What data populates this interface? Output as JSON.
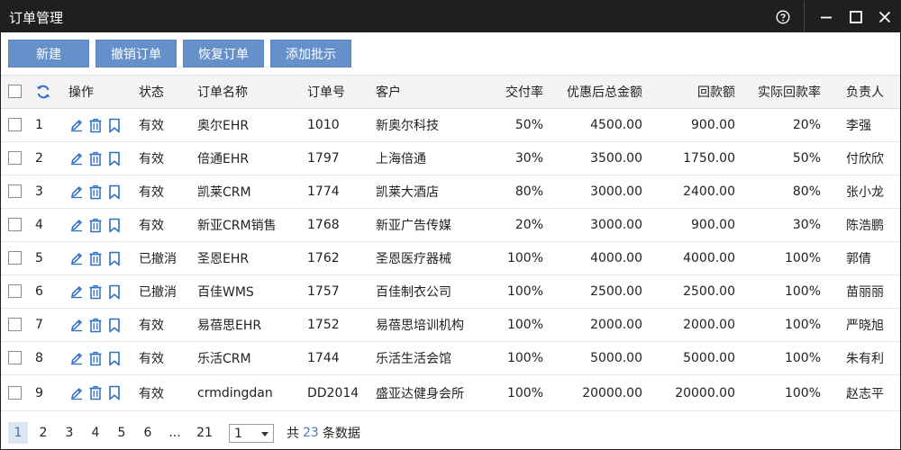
{
  "window": {
    "title": "订单管理",
    "icons": [
      "help-icon",
      "minimize-icon",
      "maximize-icon",
      "close-icon"
    ]
  },
  "toolbar": {
    "buttons": [
      "新建",
      "撤销订单",
      "恢复订单",
      "添加批示"
    ]
  },
  "columns": {
    "action": "操作",
    "status": "状态",
    "name": "订单名称",
    "order_no": "订单号",
    "customer": "客户",
    "delivery_rate": "交付率",
    "total": "优惠后总金额",
    "paid": "回款额",
    "paid_rate": "实际回款率",
    "owner": "负责人"
  },
  "rows": [
    {
      "idx": "1",
      "status": "有效",
      "name": "奥尔EHR",
      "order_no": "1010",
      "customer": "新奥尔科技",
      "delivery_rate": "50%",
      "total": "4500.00",
      "paid": "900.00",
      "paid_rate": "20%",
      "owner": "李强"
    },
    {
      "idx": "2",
      "status": "有效",
      "name": "倍通EHR",
      "order_no": "1797",
      "customer": "上海倍通",
      "delivery_rate": "30%",
      "total": "3500.00",
      "paid": "1750.00",
      "paid_rate": "50%",
      "owner": "付欣欣"
    },
    {
      "idx": "3",
      "status": "有效",
      "name": "凯莱CRM",
      "order_no": "1774",
      "customer": "凯莱大酒店",
      "delivery_rate": "80%",
      "total": "3000.00",
      "paid": "2400.00",
      "paid_rate": "80%",
      "owner": "张小龙"
    },
    {
      "idx": "4",
      "status": "有效",
      "name": "新亚CRM销售",
      "order_no": "1768",
      "customer": "新亚广告传媒",
      "delivery_rate": "20%",
      "total": "3000.00",
      "paid": "900.00",
      "paid_rate": "30%",
      "owner": "陈浩鹏"
    },
    {
      "idx": "5",
      "status": "已撤消",
      "name": "圣恩EHR",
      "order_no": "1762",
      "customer": "圣恩医疗器械",
      "delivery_rate": "100%",
      "total": "4000.00",
      "paid": "4000.00",
      "paid_rate": "100%",
      "owner": "郭倩"
    },
    {
      "idx": "6",
      "status": "已撤消",
      "name": "百佳WMS",
      "order_no": "1757",
      "customer": "百佳制衣公司",
      "delivery_rate": "100%",
      "total": "2500.00",
      "paid": "2500.00",
      "paid_rate": "100%",
      "owner": "苗丽丽"
    },
    {
      "idx": "7",
      "status": "有效",
      "name": "易蓓思EHR",
      "order_no": "1752",
      "customer": "易蓓思培训机构",
      "delivery_rate": "100%",
      "total": "2000.00",
      "paid": "2000.00",
      "paid_rate": "100%",
      "owner": "严晓旭"
    },
    {
      "idx": "8",
      "status": "有效",
      "name": "乐活CRM",
      "order_no": "1744",
      "customer": "乐活生活会馆",
      "delivery_rate": "100%",
      "total": "5000.00",
      "paid": "5000.00",
      "paid_rate": "100%",
      "owner": "朱有利"
    },
    {
      "idx": "9",
      "status": "有效",
      "name": "crmdingdan",
      "order_no": "DD2014",
      "customer": "盛亚达健身会所",
      "delivery_rate": "100%",
      "total": "20000.00",
      "paid": "20000.00",
      "paid_rate": "100%",
      "owner": "赵志平"
    }
  ],
  "pager": {
    "pages": [
      "1",
      "2",
      "3",
      "4",
      "5",
      "6",
      "...",
      "21"
    ],
    "current": "1",
    "select_value": "1",
    "total_prefix": "共",
    "total_count": "23",
    "total_suffix": "条数据"
  },
  "colors": {
    "titlebar": "#1f1f1f",
    "button": "#6690c9",
    "icon_blue": "#2f6fc4",
    "accent": "#4a78c0"
  }
}
